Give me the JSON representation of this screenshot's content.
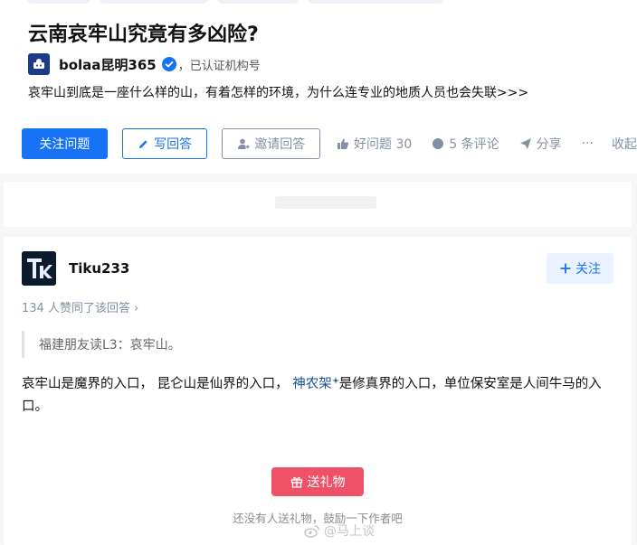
{
  "question": {
    "title": "云南哀牢山究竟有多凶险?",
    "author_name": "bolaa昆明365",
    "verified_text": "，已认证机构号",
    "description": "哀牢山到底是一座什么样的山，有着怎样的环境，为什么连专业的地质人员也会失联>>>",
    "follow_label": "关注问题",
    "write_label": "写回答",
    "invite_label": "邀请回答",
    "good_question_label": "好问题 30",
    "comments_label": "5 条评论",
    "share_label": "分享",
    "more_label": "···",
    "collapse_label": "收起"
  },
  "answer": {
    "author_name": "Tiku233",
    "follow_label": "关注",
    "upvote_text": "134 人赞同了该回答 ›",
    "quote_text": "福建朋友读L3：哀牢山。",
    "body_part1": "哀牢山是魔界的入口， 昆仑山是仙界的入口， ",
    "body_link": "神农架",
    "body_part2": "是修真界的入口，单位保安室是人间牛马的入口。",
    "gift_label": "送礼物",
    "gift_hint": "还没有人送礼物，鼓励一下作者吧"
  },
  "watermark": "@马上谈",
  "colors": {
    "primary": "#1772f6",
    "meta_gray": "#8590a6",
    "gift_red": "#ef5169",
    "link": "#175199"
  }
}
